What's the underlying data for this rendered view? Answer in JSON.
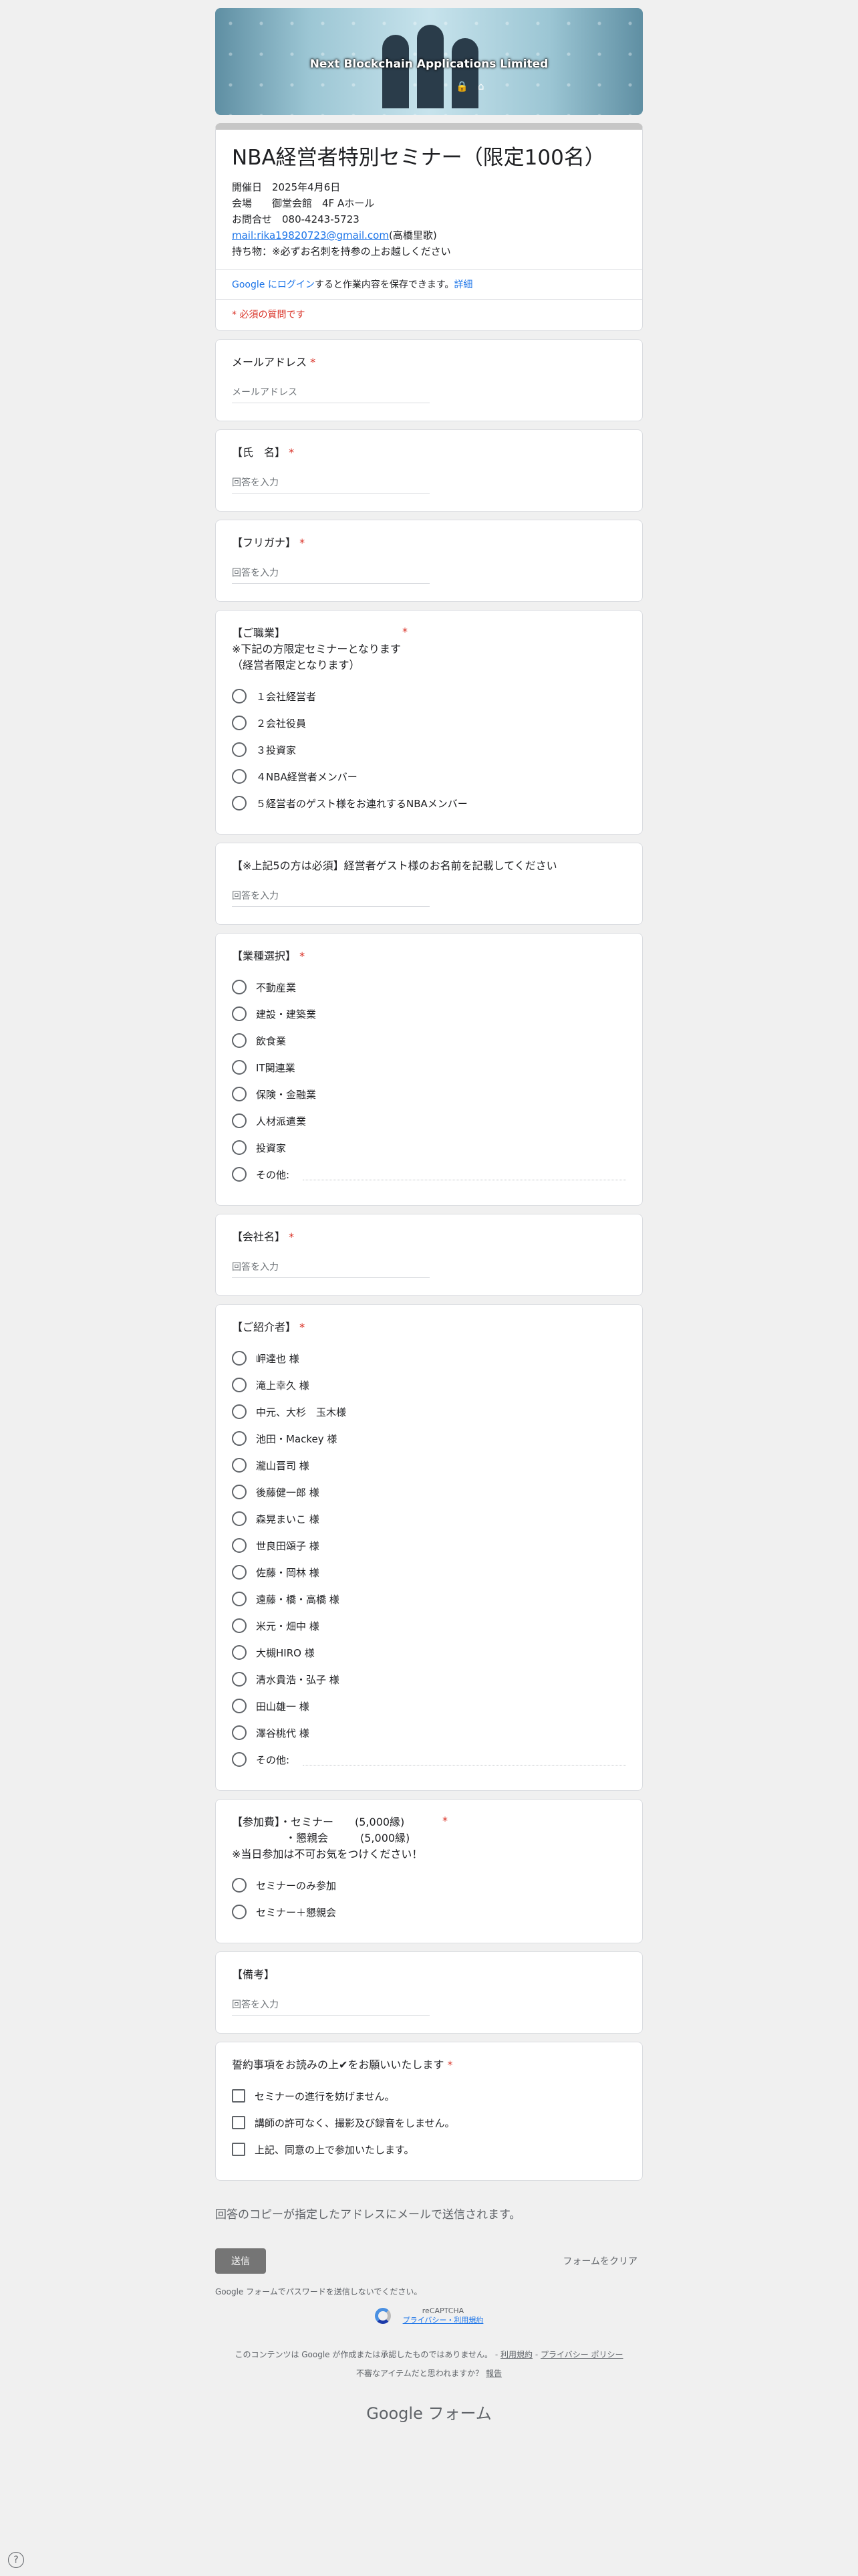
{
  "banner": {
    "title": "Next Blockchain Applications Limited"
  },
  "header": {
    "title": "NBA経営者特別セミナー（限定100名）",
    "date": "開催日　2025年4月6日",
    "venue": "会場　　御堂会館　4F Aホール",
    "contact": "お問合せ　080-4243-5723",
    "email": "mail:rika19820723@gmail.com",
    "email_suffix": "(高橋里歌)",
    "belongings": "持ち物：※必ずお名刺を持参の上お越しください",
    "login_link": "Google にログイン",
    "login_text": "すると作業内容を保存できます。",
    "login_more": "詳細",
    "required_note": "* 必須の質問です"
  },
  "questions": {
    "email": {
      "title": "メールアドレス",
      "placeholder": "メールアドレス"
    },
    "name": {
      "title": "【氏　名】",
      "placeholder": "回答を入力"
    },
    "furigana": {
      "title": "【フリガナ】",
      "placeholder": "回答を入力"
    },
    "occupation": {
      "title": "【ご職業】\n※下記の方限定セミナーとなります\n（経営者限定となります）",
      "options": [
        "１会社経営者",
        "２会社役員",
        "３投資家",
        "４NBA経営者メンバー",
        "５経営者のゲスト様をお連れするNBAメンバー"
      ]
    },
    "guest": {
      "title": "【※上記5の方は必須】経営者ゲスト様のお名前を記載してください",
      "placeholder": "回答を入力"
    },
    "industry": {
      "title": "【業種選択】",
      "options": [
        "不動産業",
        "建設・建築業",
        "飲食業",
        "IT関連業",
        "保険・金融業",
        "人材派遣業",
        "投資家"
      ],
      "other": "その他:"
    },
    "company": {
      "title": "【会社名】",
      "placeholder": "回答を入力"
    },
    "referrer": {
      "title": "【ご紹介者】",
      "options": [
        "岬達也 様",
        "滝上幸久 様",
        "中元、大杉　玉木様",
        "池田・Mackey 様",
        "瀧山晋司 様",
        "後藤健一郎 様",
        "森晃まいこ 様",
        "世良田頌子 様",
        "佐藤・岡林 様",
        "遠藤・橋・高橋 様",
        "米元・畑中 様",
        "大槻HIRO 様",
        "清水貴浩・弘子 様",
        "田山雄一 様",
        "澤谷桃代 様"
      ],
      "other": "その他:"
    },
    "fee": {
      "title": "【参加費】・セミナー　　(5,000縁)\n　　　　　・懇親会　　　(5,000縁)\n※当日参加は不可お気をつけください！",
      "options": [
        "セミナーのみ参加",
        "セミナー＋懇親会"
      ]
    },
    "remarks": {
      "title": "【備考】",
      "placeholder": "回答を入力"
    },
    "agreement": {
      "title": "誓約事項をお読みの上✔をお願いいたします",
      "options": [
        "セミナーの進行を妨げません。",
        "講師の許可なく、撮影及び録音をしません。",
        "上記、同意の上で参加いたします。"
      ]
    }
  },
  "footer": {
    "copy_notice": "回答のコピーが指定したアドレスにメールで送信されます。",
    "submit": "送信",
    "clear": "フォームをクリア",
    "password_note": "Google フォームでパスワードを送信しないでください。",
    "recaptcha": "reCAPTCHA",
    "recaptcha_links": "プライバシー・利用規約",
    "disclaimer": "このコンテンツは Google が作成または承認したものではありません。",
    "terms": "利用規約",
    "privacy": "プライバシー ポリシー",
    "abuse": "不審なアイテムだと思われますか？",
    "report": "報告",
    "brand": "Google フォーム"
  }
}
